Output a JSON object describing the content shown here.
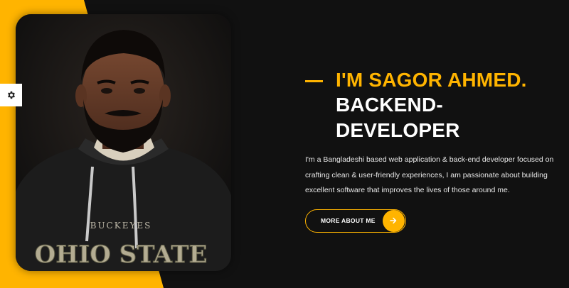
{
  "colors": {
    "accent": "#ffb400",
    "background": "#111111",
    "text": "#ffffff"
  },
  "settings": {
    "icon": "gear-icon"
  },
  "hero": {
    "name": "I'M SAGOR AHMED.",
    "role": "BACKEND-DEVELOPER",
    "bio": "I'm a Bangladeshi based web application & back-end developer focused on crafting clean & user-friendly experiences, I am passionate about building excellent software that improves the lives of those around me.",
    "button_label": "MORE ABOUT ME",
    "button_icon": "arrow-right-icon",
    "shirt_text_top": "BUCKEYES",
    "shirt_text_main": "OHIO STATE"
  }
}
